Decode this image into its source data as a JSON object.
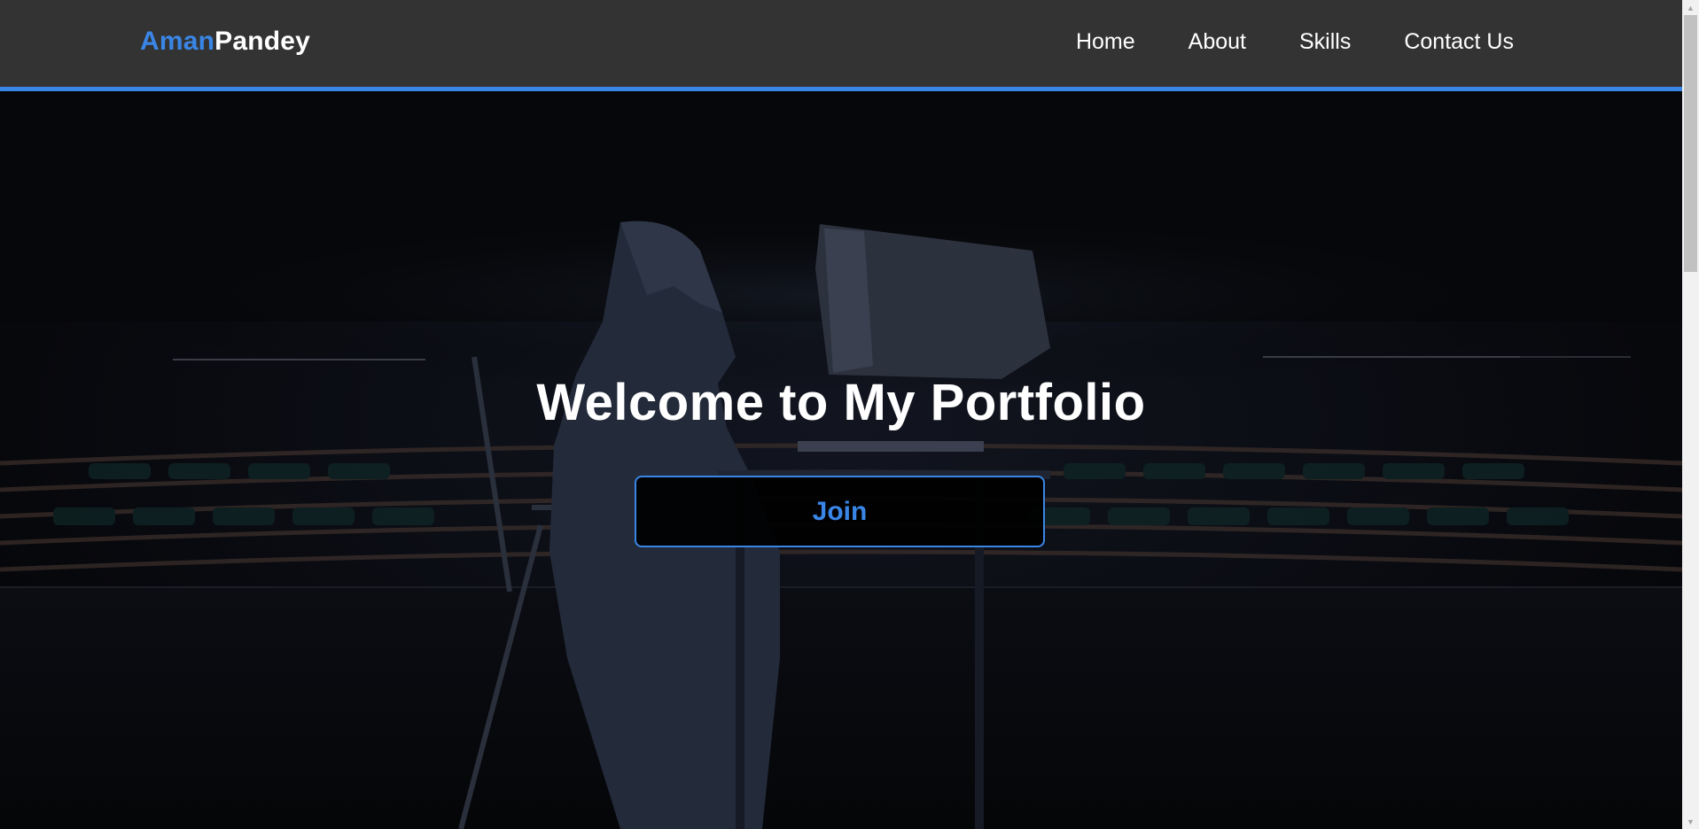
{
  "header": {
    "logo_first": "Aman",
    "logo_last": "Pandey",
    "nav": [
      {
        "label": "Home"
      },
      {
        "label": "About"
      },
      {
        "label": "Skills"
      },
      {
        "label": "Contact Us"
      }
    ]
  },
  "hero": {
    "title": "Welcome to My Portfolio",
    "button_label": "Join",
    "background_image": "hooded-person-at-computer-in-empty-theater"
  },
  "colors": {
    "accent": "#3a86e6",
    "navbar_bg": "#333333",
    "text": "#ffffff"
  }
}
